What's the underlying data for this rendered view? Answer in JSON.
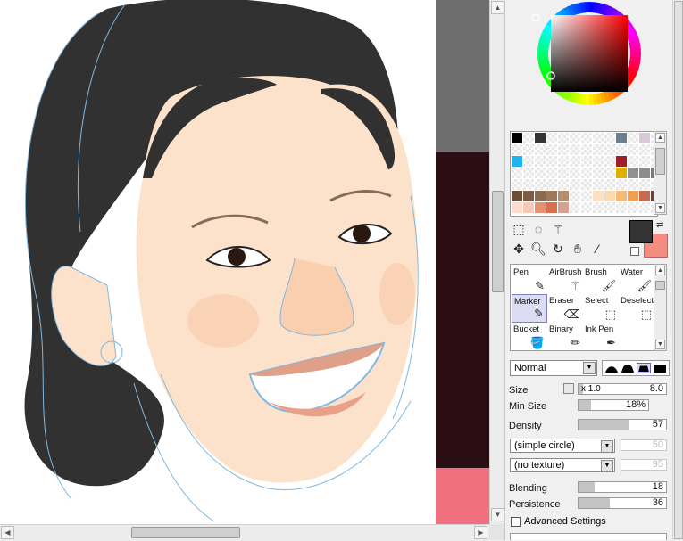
{
  "colors": {
    "hair": "#313131",
    "skin": "#fde2cb",
    "foreground": "#333333",
    "background": "#f58c80",
    "sketch_line": "#7fb8e0",
    "selected_bg": "#dcdcf4"
  },
  "swatches": [
    [
      "#000000",
      "",
      "#333333",
      "",
      "",
      "",
      "",
      "",
      "",
      "#6b7f8f",
      "",
      "#d8c8d8",
      ""
    ],
    [
      "",
      "",
      "",
      "",
      "",
      "",
      "",
      "",
      "",
      "",
      "",
      "",
      ""
    ],
    [
      "#1eb4f0",
      "",
      "",
      "",
      "",
      "",
      "",
      "",
      "",
      "#a01e2a",
      "",
      "",
      ""
    ],
    [
      "",
      "",
      "",
      "",
      "",
      "",
      "",
      "",
      "",
      "#e0b000",
      "#909090",
      "#8c8c8c",
      "#7a7a7a"
    ],
    [
      "",
      "",
      "",
      "",
      "",
      "",
      "",
      "",
      "",
      "",
      "",
      "",
      ""
    ],
    [
      "#6e4e36",
      "#7c5c44",
      "#8c6a50",
      "#a07858",
      "#b88c68",
      "",
      "",
      "#fbe0c4",
      "#fad8b0",
      "#f8b878",
      "#f0a050",
      "#c86a50",
      "#704030"
    ],
    [
      "#ffdcd0",
      "#f8c8b8",
      "#e89070",
      "#d87050",
      "#d8a090",
      "",
      "",
      "",
      "",
      "",
      "",
      "",
      ""
    ]
  ],
  "tools": {
    "row1": [
      "select-rect-icon",
      "lasso-icon",
      "magic-wand-icon",
      "",
      ""
    ],
    "row2": [
      "move-icon",
      "zoom-icon",
      "rotate-icon",
      "hand-icon",
      "eyedropper-icon"
    ]
  },
  "brushes": [
    {
      "label": "Pen",
      "icon": "✎",
      "name": "pen"
    },
    {
      "label": "AirBrush",
      "icon": "⚚",
      "name": "airbrush"
    },
    {
      "label": "Brush",
      "icon": "🖌",
      "name": "brush"
    },
    {
      "label": "Water",
      "icon": "🖌",
      "name": "water"
    },
    {
      "label": "Marker",
      "icon": "✎",
      "name": "marker",
      "selected": true
    },
    {
      "label": "Eraser",
      "icon": "⌫",
      "name": "eraser"
    },
    {
      "label": "Select",
      "icon": "⬚",
      "name": "select"
    },
    {
      "label": "Deselect",
      "icon": "⬚",
      "name": "deselect"
    },
    {
      "label": "Bucket",
      "icon": "🪣",
      "name": "bucket"
    },
    {
      "label": "Binary",
      "icon": "✏",
      "name": "binary"
    },
    {
      "label": "Ink Pen",
      "icon": "✒",
      "name": "ink-pen"
    }
  ],
  "blend_mode": "Normal",
  "size": {
    "label": "Size",
    "multiplier": "x 1.0",
    "value": "8.0",
    "fill": 0.05
  },
  "min_size": {
    "label": "Min Size",
    "value": "18%",
    "fill": 0.18
  },
  "density": {
    "label": "Density",
    "value": "57",
    "fill": 0.57
  },
  "shape_select": "(simple circle)",
  "shape_value": "50",
  "texture_select": "(no texture)",
  "texture_value": "95",
  "blending": {
    "label": "Blending",
    "value": "18",
    "fill": 0.18
  },
  "persistence": {
    "label": "Persistence",
    "value": "36",
    "fill": 0.36
  },
  "advanced_settings": "Advanced Settings"
}
